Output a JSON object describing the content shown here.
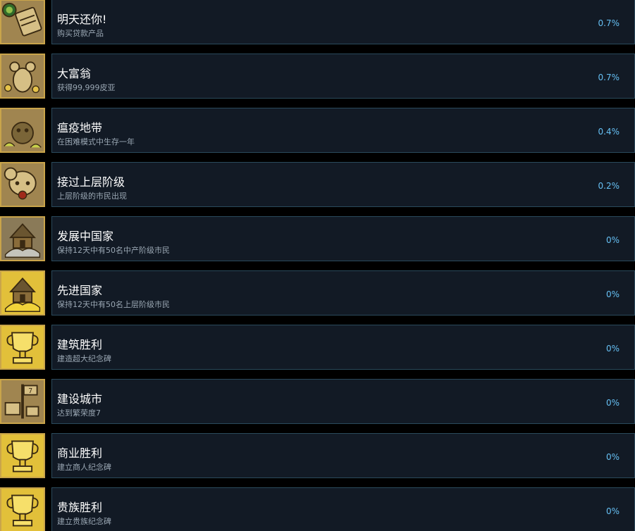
{
  "achievements": [
    {
      "title": "明天还你!",
      "desc": "购买贷款产品",
      "percent": "0.7%",
      "icon": "loan-scroll-icon",
      "tone": "sepia"
    },
    {
      "title": "大富翁",
      "desc": "获得99,999皮亚",
      "percent": "0.7%",
      "icon": "rich-rat-icon",
      "tone": "sepia"
    },
    {
      "title": "瘟疫地带",
      "desc": "在困难模式中生存一年",
      "percent": "0.4%",
      "icon": "plague-rat-icon",
      "tone": "sepia"
    },
    {
      "title": "接过上层阶级",
      "desc": "上层阶级的市民出现",
      "percent": "0.2%",
      "icon": "upper-class-rat-icon",
      "tone": "sepia"
    },
    {
      "title": "发展中国家",
      "desc": "保持12天中有50名中产阶级市民",
      "percent": "0%",
      "icon": "developing-city-icon",
      "tone": "silver"
    },
    {
      "title": "先进国家",
      "desc": "保持12天中有50名上层阶级市民",
      "percent": "0%",
      "icon": "advanced-city-icon",
      "tone": "gold"
    },
    {
      "title": "建筑胜利",
      "desc": "建造超大纪念碑",
      "percent": "0%",
      "icon": "monument-trophy-icon",
      "tone": "gold"
    },
    {
      "title": "建设城市",
      "desc": "达到繁荣度7",
      "percent": "0%",
      "icon": "city-signpost-icon",
      "tone": "sepia"
    },
    {
      "title": "商业胜利",
      "desc": "建立商人纪念碑",
      "percent": "0%",
      "icon": "merchant-trophy-icon",
      "tone": "gold"
    },
    {
      "title": "贵族胜利",
      "desc": "建立贵族纪念碑",
      "percent": "0%",
      "icon": "noble-trophy-icon",
      "tone": "gold"
    }
  ],
  "colors": {
    "page_bg": "#000000",
    "panel_bg": "#121a25",
    "panel_border": "#2a4a5c",
    "title_text": "#ffffff",
    "desc_text": "#9aa7b3",
    "percent_text": "#66c0f4",
    "icon_sepia": "#a08550",
    "icon_gold": "#e2c03a",
    "icon_silver": "#c4c4bc"
  }
}
